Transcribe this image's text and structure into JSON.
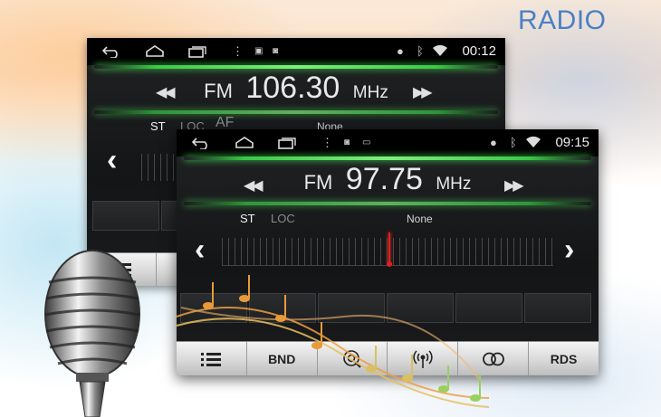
{
  "banner": {
    "title": "RADIO"
  },
  "back_screen": {
    "status": {
      "clock": "00:12"
    },
    "radio": {
      "band": "FM",
      "frequency": "106.30",
      "unit": "MHz"
    },
    "flags": {
      "st": "ST",
      "loc": "LOC",
      "af": "AF"
    },
    "rds_text": "None"
  },
  "front_screen": {
    "status": {
      "clock": "09:15"
    },
    "radio": {
      "band": "FM",
      "frequency": "97.75",
      "unit": "MHz"
    },
    "flags": {
      "st": "ST",
      "loc": "LOC"
    },
    "rds_text": "None",
    "toolbar": {
      "list_icon": "list-icon",
      "band_label": "BND",
      "scan_icon": "search-scan-icon",
      "signal_icon": "broadcast-icon",
      "stereo_icon": "stereo-icon",
      "rds_label": "RDS"
    }
  },
  "colors": {
    "accent_green": "#49e25a",
    "needle_red": "#e02020",
    "banner_blue": "#4a80c4"
  }
}
